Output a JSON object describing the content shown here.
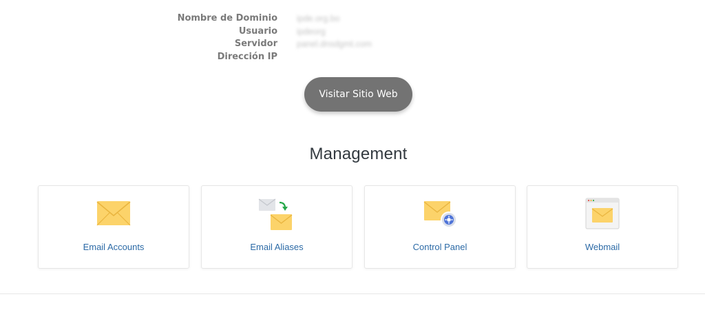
{
  "info": {
    "rows": [
      {
        "label": "Nombre de Dominio",
        "value": "ipde.org.bo"
      },
      {
        "label": "Usuario",
        "value": "ipdeorg"
      },
      {
        "label": "Servidor",
        "value": "panel.dnsdgmt.com"
      },
      {
        "label": "Dirección IP",
        "value": ""
      }
    ]
  },
  "visit_button": {
    "label": "Visitar Sitio Web"
  },
  "management": {
    "title": "Management",
    "cards": [
      {
        "label": "Email Accounts",
        "icon": "envelope-icon"
      },
      {
        "label": "Email Aliases",
        "icon": "email-forward-icon"
      },
      {
        "label": "Control Panel",
        "icon": "email-settings-icon"
      },
      {
        "label": "Webmail",
        "icon": "webmail-browser-icon"
      }
    ]
  },
  "colors": {
    "envelope": "#fcd36a",
    "link": "#2c6aa6",
    "button": "#737373"
  }
}
